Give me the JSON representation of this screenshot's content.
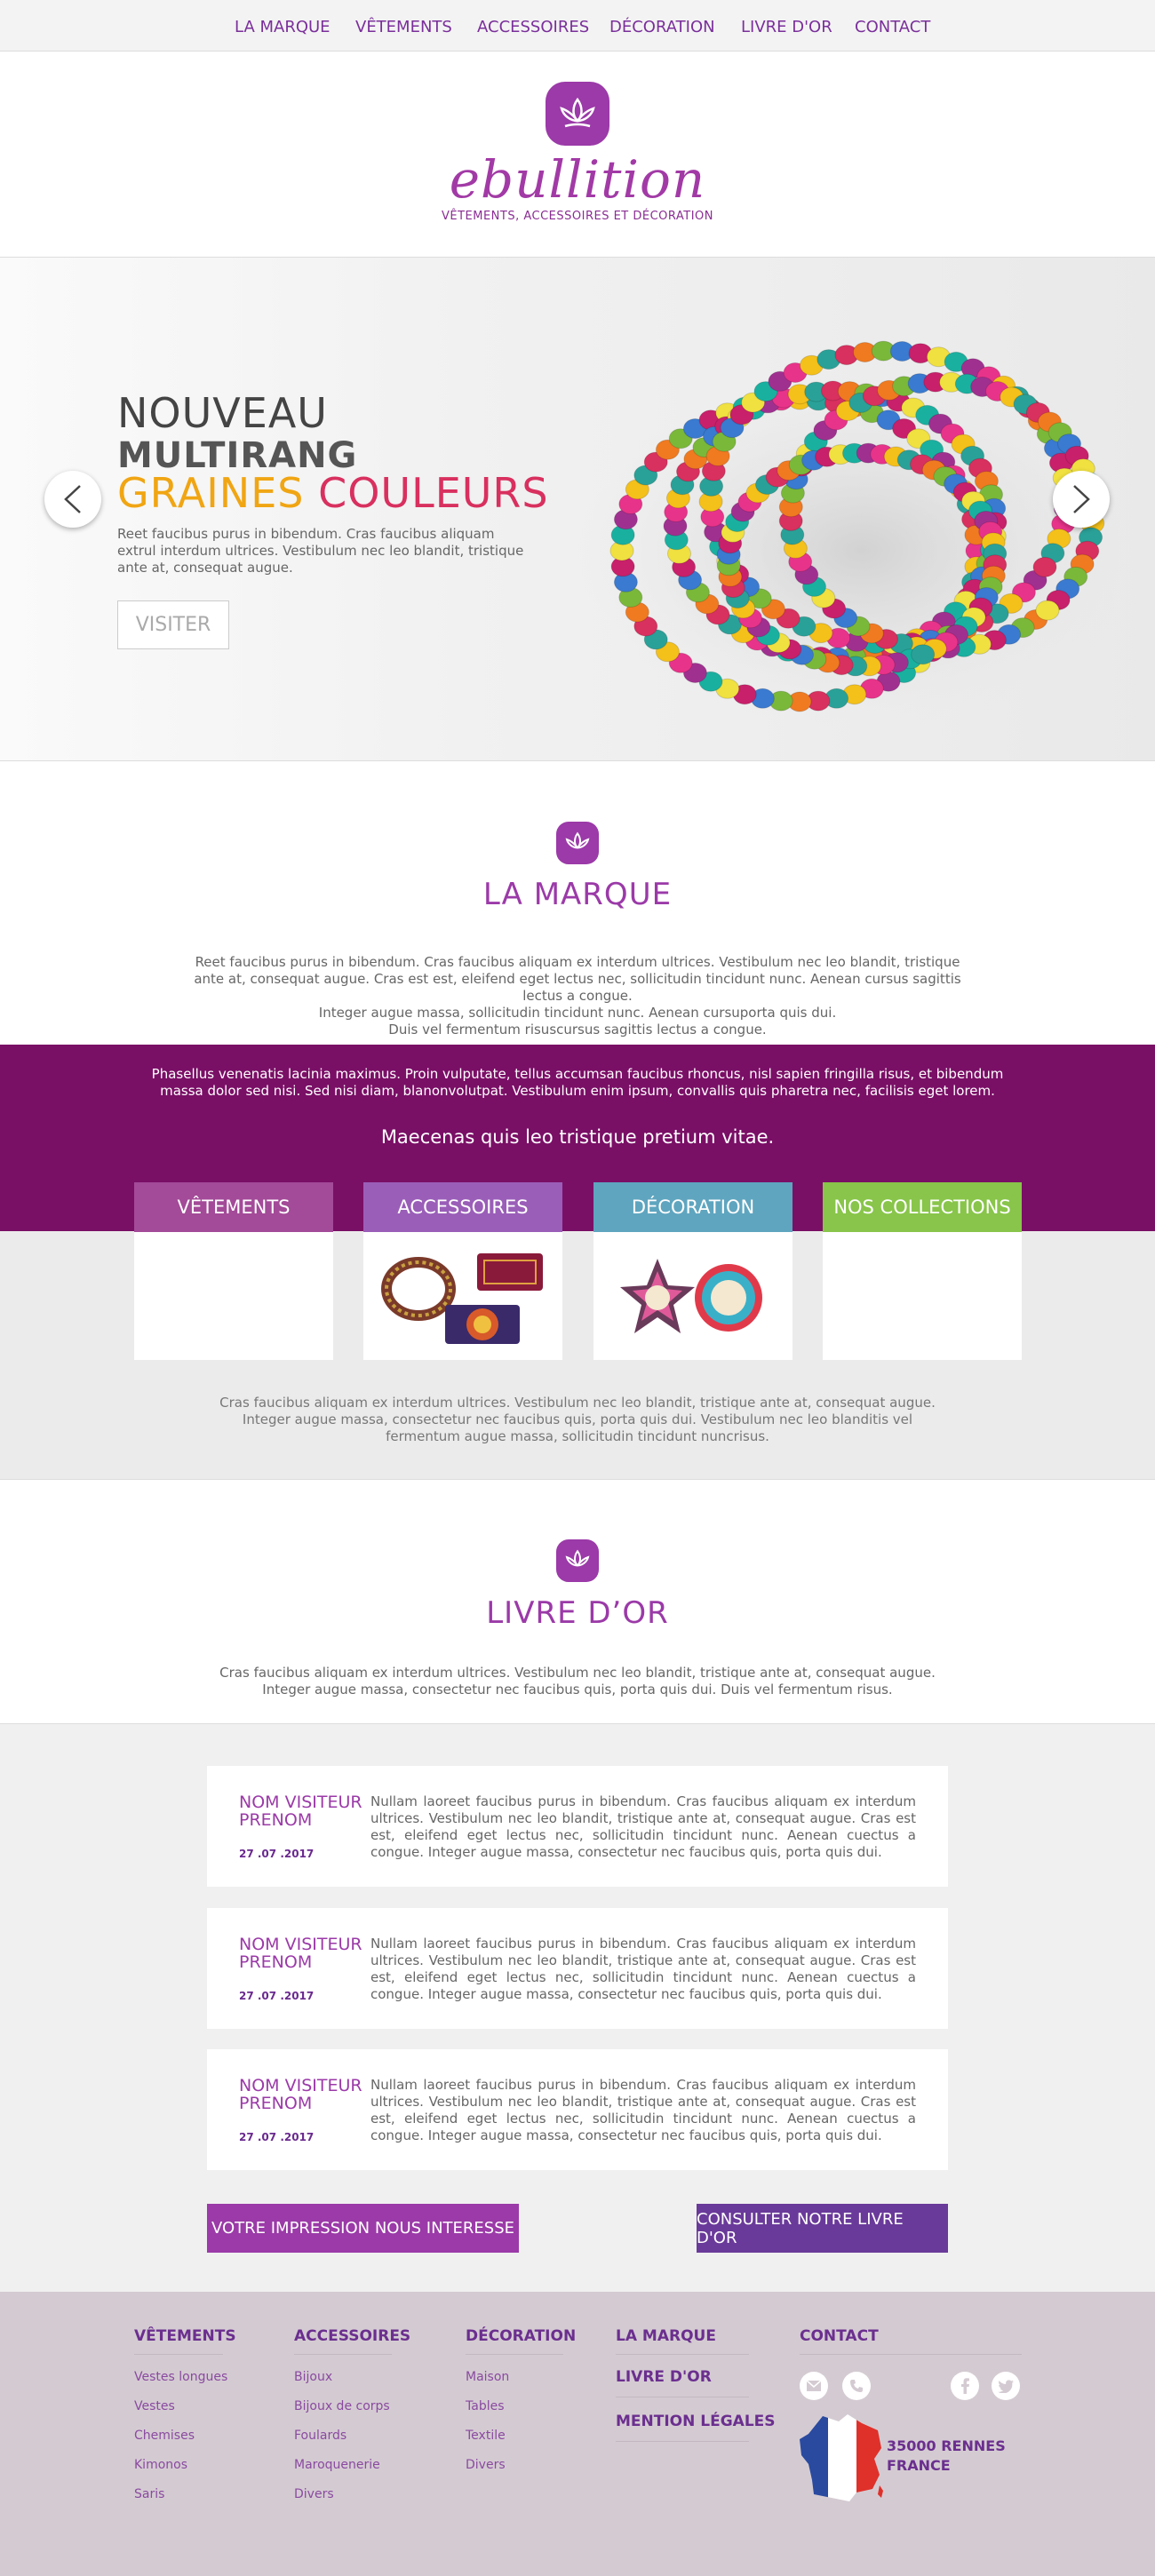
{
  "nav": {
    "items": [
      "LA MARQUE",
      "VÊTEMENTS",
      "ACCESSOIRES",
      "DÉCORATION",
      "LIVRE D'OR",
      "CONTACT"
    ]
  },
  "header": {
    "brand": "ebullition",
    "tagline": "VÊTEMENTS, ACCESSOIRES ET DÉCORATION"
  },
  "hero": {
    "line1": "NOUVEAU",
    "line2": "MULTIRANG",
    "line3a": "GRAINES",
    "line3b": "COULEURS",
    "text": "Reet faucibus purus in bibendum. Cras faucibus aliquam extrul interdum ultrices. Vestibulum nec leo blandit, tristique ante at, consequat augue.",
    "button": "VISITER",
    "colors": {
      "yellow": "#f0a513",
      "pink": "#d8305f"
    }
  },
  "marque": {
    "title": "LA MARQUE",
    "p1": "Reet faucibus purus in bibendum. Cras faucibus aliquam ex interdum ultrices. Vestibulum nec leo blandit, tristique ante at, consequat augue. Cras est est, eleifend eget lectus nec, sollicitudin tincidunt nunc. Aenean cursus sagittis lectus a congue.",
    "p2": "Integer augue massa, sollicitudin tincidunt nunc. Aenean cursuporta quis dui.",
    "p3": "Duis vel fermentum risuscursus sagittis lectus a congue."
  },
  "collections": {
    "intro": "Phasellus venenatis lacinia maximus. Proin vulputate, tellus accumsan faucibus rhoncus, nisl sapien fringilla risus, et bibendum massa dolor sed nisi. Sed nisi diam, blanonvolutpat. Vestibulum enim ipsum, convallis quis pharetra nec, facilisis eget lorem.",
    "subtitle": "Maecenas quis leo tristique pretium vitae.",
    "cards": [
      {
        "label": "VÊTEMENTS",
        "color": "#a34a98"
      },
      {
        "label": "ACCESSOIRES",
        "color": "#9a5eb8"
      },
      {
        "label": "DÉCORATION",
        "color": "#5fa5bf"
      },
      {
        "label": "NOS COLLECTIONS",
        "color": "#88c54a"
      }
    ],
    "text": "Cras faucibus aliquam ex interdum ultrices. Vestibulum nec leo blandit, tristique ante at, consequat augue. Integer augue massa, consectetur nec faucibus quis, porta quis dui. Vestibulum nec leo blanditis vel fermentum augue massa, sollicitudin tincidunt nuncrisus."
  },
  "livre": {
    "title": "LIVRE D’OR",
    "text": "Cras faucibus aliquam ex interdum ultrices. Vestibulum nec leo blandit, tristique ante at, consequat augue. Integer augue massa, consectetur nec faucibus quis, porta quis dui. Duis vel fermentum risus.",
    "entries": [
      {
        "name": "NOM VISITEUR PRENOM",
        "date": "27 .07 .2017",
        "text": "Nullam laoreet faucibus purus in bibendum. Cras faucibus aliquam ex interdum ultrices. Vestibulum nec leo blandit, tristique ante at, consequat augue. Cras est est, eleifend eget lectus nec, sollicitudin tincidunt nunc. Aenean cuectus a congue. Integer augue massa, consectetur nec faucibus quis, porta quis dui."
      },
      {
        "name": "NOM VISITEUR PRENOM",
        "date": "27 .07 .2017",
        "text": "Nullam laoreet faucibus purus in bibendum. Cras faucibus aliquam ex interdum ultrices. Vestibulum nec leo blandit, tristique ante at, consequat augue. Cras est est, eleifend eget lectus nec, sollicitudin tincidunt nunc. Aenean cuectus a congue. Integer augue massa, consectetur nec faucibus quis, porta quis dui."
      },
      {
        "name": "NOM VISITEUR PRENOM",
        "date": "27 .07 .2017",
        "text": "Nullam laoreet faucibus purus in bibendum. Cras faucibus aliquam ex interdum ultrices. Vestibulum nec leo blandit, tristique ante at, consequat augue. Cras est est, eleifend eget lectus nec, sollicitudin tincidunt nunc. Aenean cuectus a congue. Integer augue massa, consectetur nec faucibus quis, porta quis dui."
      }
    ],
    "btn_left": "VOTRE IMPRESSION NOUS INTERESSE",
    "btn_right": "CONSULTER NOTRE LIVRE D'OR"
  },
  "footer": {
    "col1": {
      "head": "VÊTEMENTS",
      "links": [
        "Vestes longues",
        "Vestes",
        "Chemises",
        "Kimonos",
        "Saris"
      ]
    },
    "col2": {
      "head": "ACCESSOIRES",
      "links": [
        "Bijoux",
        "Bijoux de corps",
        "Foulards",
        "Maroquenerie",
        "Divers"
      ]
    },
    "col3": {
      "head": "DÉCORATION",
      "links": [
        "Maison",
        "Tables",
        "Textile",
        "Divers"
      ]
    },
    "col4": [
      "LA MARQUE",
      "LIVRE D'OR",
      "MENTION LÉGALES"
    ],
    "contact": {
      "head": "CONTACT",
      "line1": "35000 RENNES",
      "line2": "FRANCE"
    },
    "icons": [
      "mail-icon",
      "phone-icon",
      "facebook-icon",
      "twitter-icon",
      "france-map-icon"
    ]
  }
}
